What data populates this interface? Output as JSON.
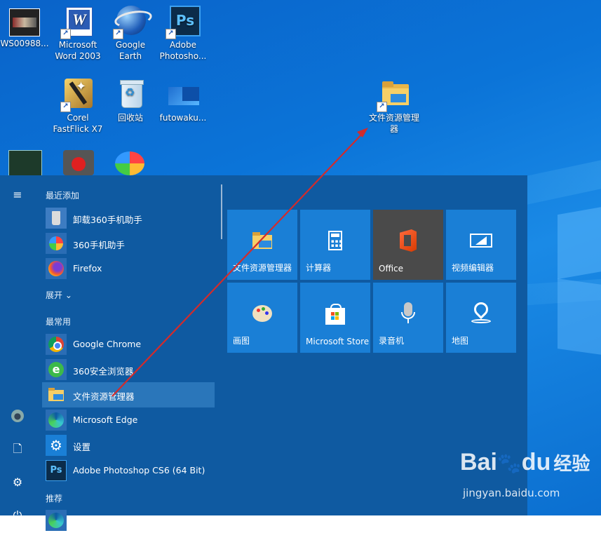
{
  "desktop": {
    "icons": [
      {
        "label": "WS00988..."
      },
      {
        "label": "Microsoft Word 2003"
      },
      {
        "label": "Google Earth"
      },
      {
        "label": "Adobe Photosho..."
      },
      {
        "label": "Corel FastFlick X7"
      },
      {
        "label": "回收站"
      },
      {
        "label": "futowaku..."
      },
      {
        "label": "文件资源管理器"
      }
    ]
  },
  "start_menu": {
    "sections": {
      "recent": "最近添加",
      "expand": "展开",
      "frequent": "最常用",
      "recommend": "推荐"
    },
    "recent_apps": [
      {
        "label": "卸载360手机助手",
        "icon": "trash-can-icon"
      },
      {
        "label": "360手机助手",
        "icon": "360-assistant-icon"
      },
      {
        "label": "Firefox",
        "icon": "firefox-icon"
      }
    ],
    "frequent_apps": [
      {
        "label": "Google Chrome",
        "icon": "chrome-icon"
      },
      {
        "label": "360安全浏览器",
        "icon": "360-browser-icon"
      },
      {
        "label": "文件资源管理器",
        "icon": "folder-icon",
        "selected": true
      },
      {
        "label": "Microsoft Edge",
        "icon": "edge-icon"
      },
      {
        "label": "设置",
        "icon": "gear-icon"
      },
      {
        "label": "Adobe Photoshop CS6 (64 Bit)",
        "icon": "photoshop-icon"
      }
    ],
    "recommend_apps": [
      {
        "label": "Microsoft Edge",
        "icon": "edge-icon"
      }
    ],
    "tiles": [
      {
        "label": "文件资源管理器",
        "icon": "folder-icon",
        "color": "#1a7fd6"
      },
      {
        "label": "计算器",
        "icon": "calculator-icon",
        "color": "#1a7fd6"
      },
      {
        "label": "Office",
        "icon": "office-icon",
        "color": "#4a4a4a"
      },
      {
        "label": "视频编辑器",
        "icon": "video-editor-icon",
        "color": "#1a7fd6"
      },
      {
        "label": "画图",
        "icon": "paint-palette-icon",
        "color": "#1a7fd6"
      },
      {
        "label": "Microsoft Store",
        "icon": "store-bag-icon",
        "color": "#1a7fd6"
      },
      {
        "label": "录音机",
        "icon": "microphone-icon",
        "color": "#1a7fd6"
      },
      {
        "label": "地图",
        "icon": "map-pin-icon",
        "color": "#1a7fd6"
      }
    ]
  },
  "watermark": {
    "brand": "Bai",
    "brand2": "du",
    "cn": "经验",
    "url": "jingyan.baidu.com"
  },
  "colors": {
    "start_bg": "#0f5aa1",
    "tile": "#1a7fd6",
    "selected": "#2a76ba",
    "arrow": "#d32b2b"
  }
}
